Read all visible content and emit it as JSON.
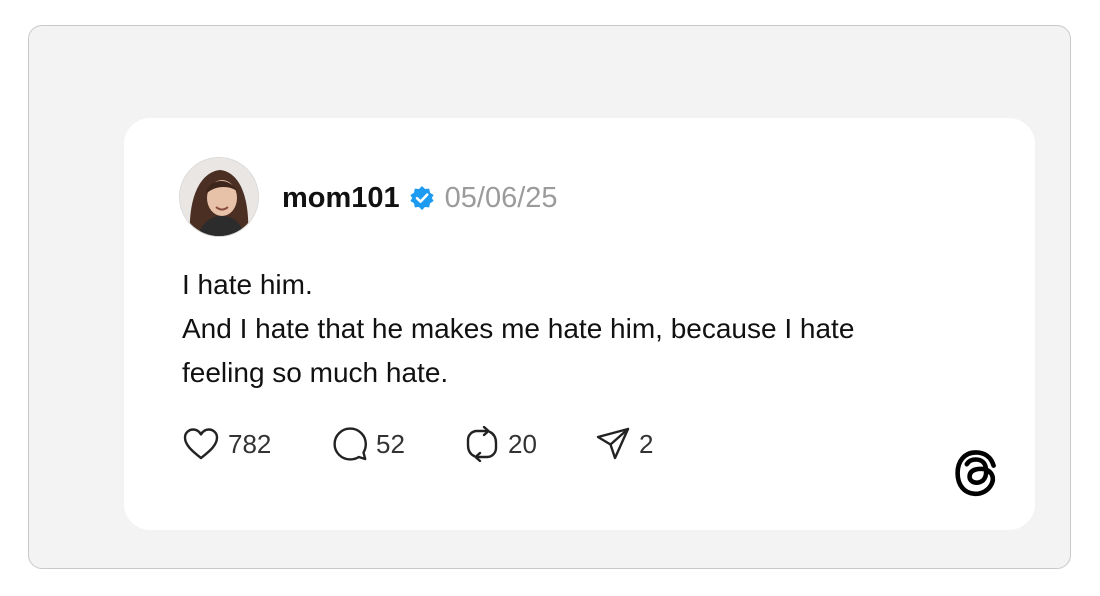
{
  "post": {
    "username": "mom101",
    "date": "05/06/25",
    "verified": true,
    "body_lines": [
      "I hate him.",
      "And I hate that he makes me hate him, because I hate",
      "feeling so much hate."
    ],
    "actions": {
      "likes": "782",
      "comments": "52",
      "reposts": "20",
      "shares": "2"
    }
  },
  "icons": {
    "verified": "verified-badge-icon",
    "like": "heart-icon",
    "comment": "comment-bubble-icon",
    "repost": "repost-icon",
    "share": "send-icon",
    "brand": "threads-logo-icon"
  },
  "colors": {
    "verified_blue": "#1d9bf0",
    "date_gray": "#9b9b9b",
    "text": "#111111",
    "frame_bg": "#f3f3f3"
  }
}
